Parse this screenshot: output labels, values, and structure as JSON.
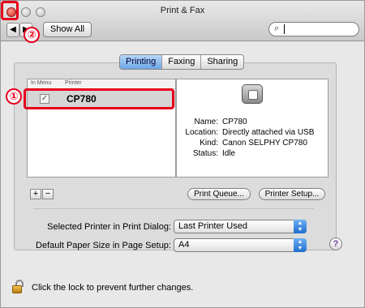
{
  "window": {
    "title": "Print & Fax"
  },
  "toolbar": {
    "back_label": "◀",
    "forward_label": "▶",
    "show_all_label": "Show All",
    "search_icon": "search-icon",
    "search_value": ""
  },
  "callouts": {
    "one": "①",
    "two": "②"
  },
  "tabs": [
    {
      "label": "Printing",
      "active": true
    },
    {
      "label": "Faxing",
      "active": false
    },
    {
      "label": "Sharing",
      "active": false
    }
  ],
  "printer_list": {
    "headers": [
      "In Menu",
      "Printer"
    ],
    "rows": [
      {
        "in_menu": true,
        "name": "CP780"
      }
    ]
  },
  "printer_info": {
    "icon": "printer-icon",
    "fields": [
      {
        "key": "Name:",
        "value": "CP780"
      },
      {
        "key": "Location:",
        "value": "Directly attached via USB"
      },
      {
        "key": "Kind:",
        "value": "Canon SELPHY CP780"
      },
      {
        "key": "Status:",
        "value": "Idle"
      }
    ]
  },
  "list_buttons": {
    "add": "+",
    "remove": "−"
  },
  "buttons": {
    "print_queue": "Print Queue...",
    "printer_setup": "Printer Setup..."
  },
  "settings": {
    "selected_printer_label": "Selected Printer in Print Dialog:",
    "selected_printer_value": "Last Printer Used",
    "paper_size_label": "Default Paper Size in Page Setup:",
    "paper_size_value": "A4"
  },
  "help_label": "?",
  "lock_text": "Click the lock to prevent further changes.",
  "colors": {
    "callout_red": "#e6001b",
    "tab_active": "#6ea6e5",
    "popup_blue": "#1f6fd0"
  }
}
